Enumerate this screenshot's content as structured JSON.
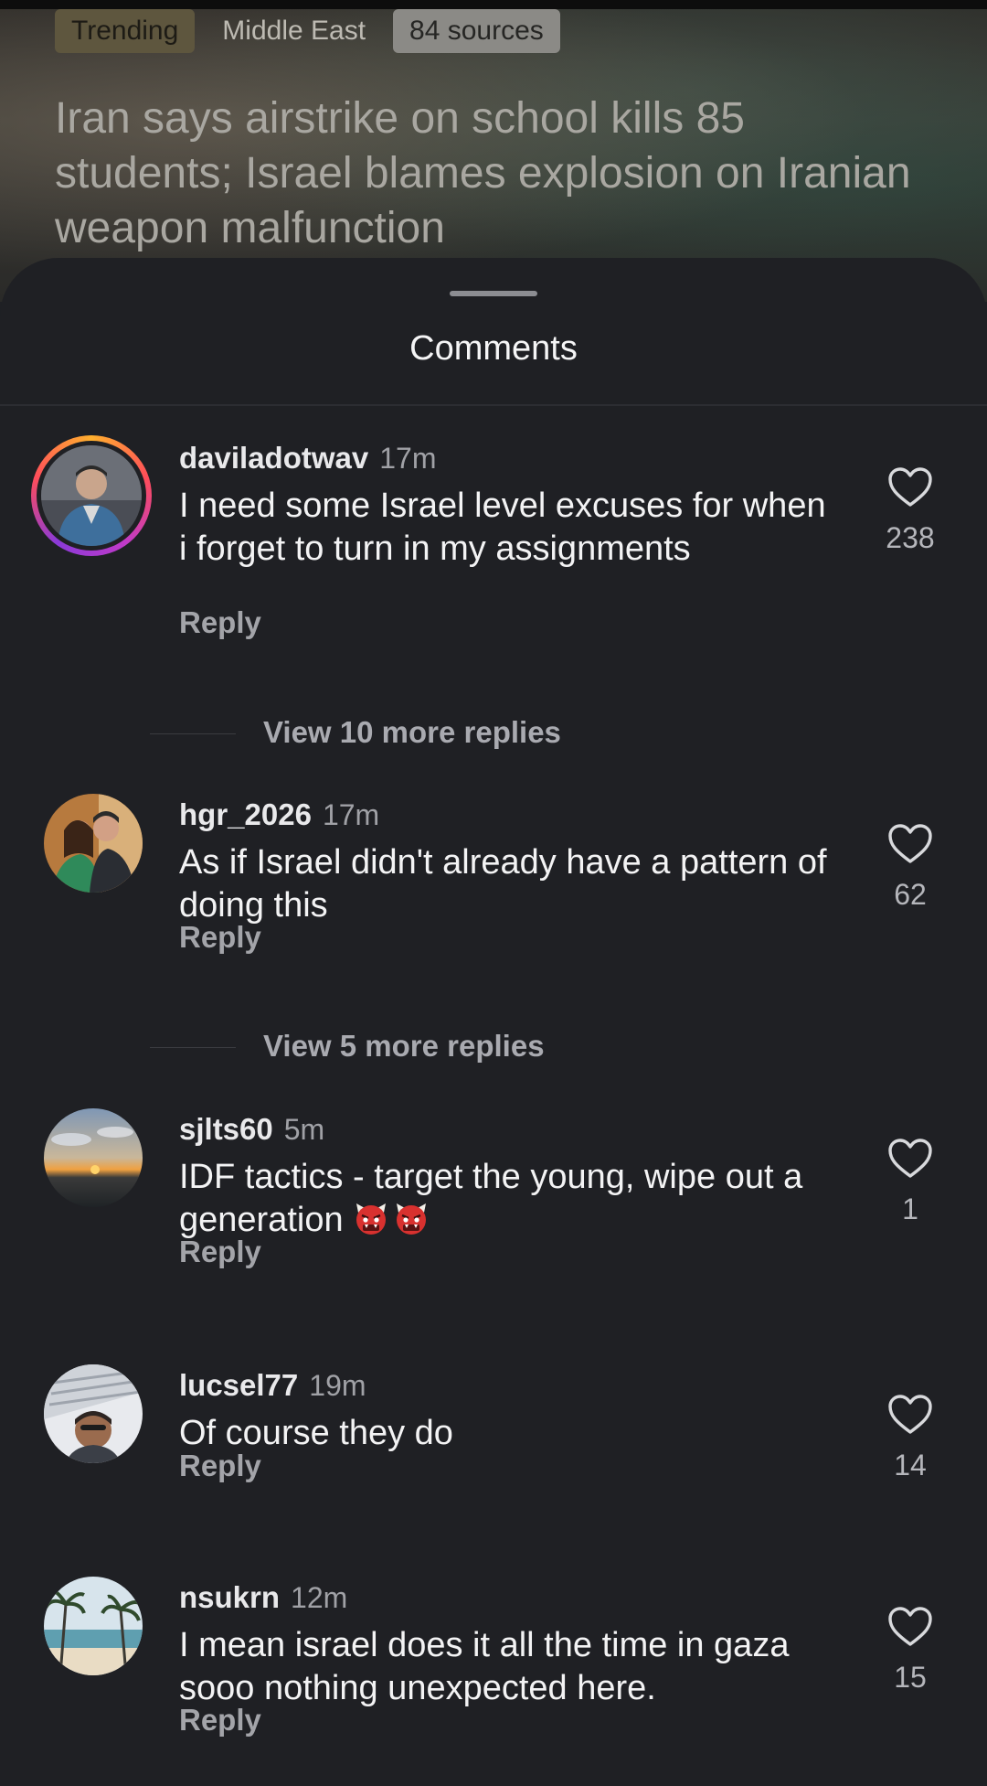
{
  "story": {
    "chips": [
      "Trending",
      "Middle East",
      "84 sources"
    ],
    "headline": "Iran says airstrike on school kills 85 students; Israel blames explosion on Iranian weapon malfunction"
  },
  "comments_sheet": {
    "title": "Comments",
    "reply_label": "Reply",
    "comments": [
      {
        "username": "daviladotwav",
        "time": "17m",
        "text": "I need some Israel level excuses for when i forget to turn in my assignments",
        "likes": "238",
        "more_replies": "View 10 more replies"
      },
      {
        "username": "hgr_2026",
        "time": "17m",
        "text": "As if Israel didn't already have a pattern of doing this",
        "likes": "62",
        "more_replies": "View 5 more replies"
      },
      {
        "username": "sjlts60",
        "time": "5m",
        "text": "IDF tactics - target the young, wipe out a generation",
        "emoji": "ogre-emoji",
        "likes": "1"
      },
      {
        "username": "lucsel77",
        "time": "19m",
        "text": "Of course they do",
        "likes": "14"
      },
      {
        "username": "nsukrn",
        "time": "12m",
        "text": "I mean israel does it all the time in gaza sooo nothing unexpected here.",
        "likes": "15"
      }
    ]
  },
  "colors": {
    "sheet_bg": "#1f2024",
    "text_primary": "#f3f3f4",
    "text_secondary": "#a3a4a9",
    "story_ring": [
      "#ffb02e",
      "#ff4d5a",
      "#c03ac8"
    ]
  },
  "icons": {
    "like": "heart-outline-icon"
  }
}
